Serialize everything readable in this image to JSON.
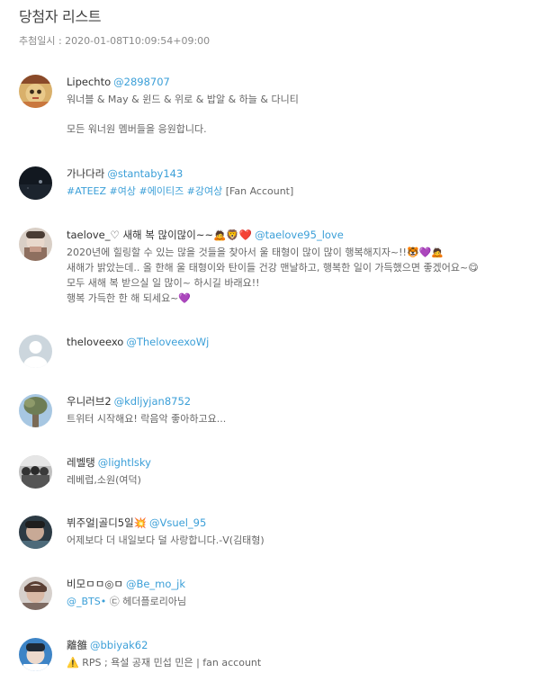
{
  "header": {
    "title": "당첨자 리스트",
    "draw_time": "추첨일시 : 2020-01-08T10:09:54+09:00"
  },
  "winners": [
    {
      "name": "Lipechto",
      "handle": "@2898707",
      "lines": [
        "워너블 & May & 윈드 & 위로 & 밥알 & 하늘 & 다니티",
        "모든 워너원 멤버들을 응원합니다."
      ]
    },
    {
      "name": "가나다라",
      "handle": "@stantaby143",
      "tags": "#ATEEZ #여상 #에이티즈 #강여상",
      "tag_suffix": " [Fan Account]"
    },
    {
      "name": "taelove_♡ 새해 복 많이많이~~🙇🦁❤️",
      "handle": "@taelove95_love",
      "lines": [
        "2020년에 힐링할 수 있는 많을 것들을 찾아서 울 태형이 많이 많이 행복해지자~!!🐯💜🙇",
        "새해가 밝았는데.. 올 한해 울 태형이와 탄이들 건강 맨날하고, 행복한 일이 가득했으면 좋겠어요~😋",
        "모두 새해 복 받으실 일 많이~ 하시길 바래요!!",
        "행복 가득한 한 해 되세요~💜"
      ]
    },
    {
      "name": "theloveexo",
      "handle": "@TheloveexoWj"
    },
    {
      "name": "우니러브2",
      "handle": "@kdljyjan8752",
      "lines": [
        "트위터 시작해요! 락음악 좋아하고요..."
      ]
    },
    {
      "name": "레벨탱",
      "handle": "@lightlsky",
      "lines": [
        "레베럽,소원(여덕)"
      ]
    },
    {
      "name": "뷔주얼|골디5일💥",
      "handle": "@Vsuel_95",
      "lines": [
        "어제보다 더 내일보다 덜 사랑합니다.-V(김태형)"
      ]
    },
    {
      "name": "비모ㅁㅁ◎ㅁ",
      "handle": "@Be_mo_jk",
      "tag_prefix": "@_BTS•",
      "tag_rest": " ㉢ 헤더플로리아님"
    },
    {
      "name": "離雒",
      "handle": "@bbiyak62",
      "lines": [
        "⚠️ RPS ; 욕설 공재 민섭 민은 | fan account"
      ]
    }
  ]
}
